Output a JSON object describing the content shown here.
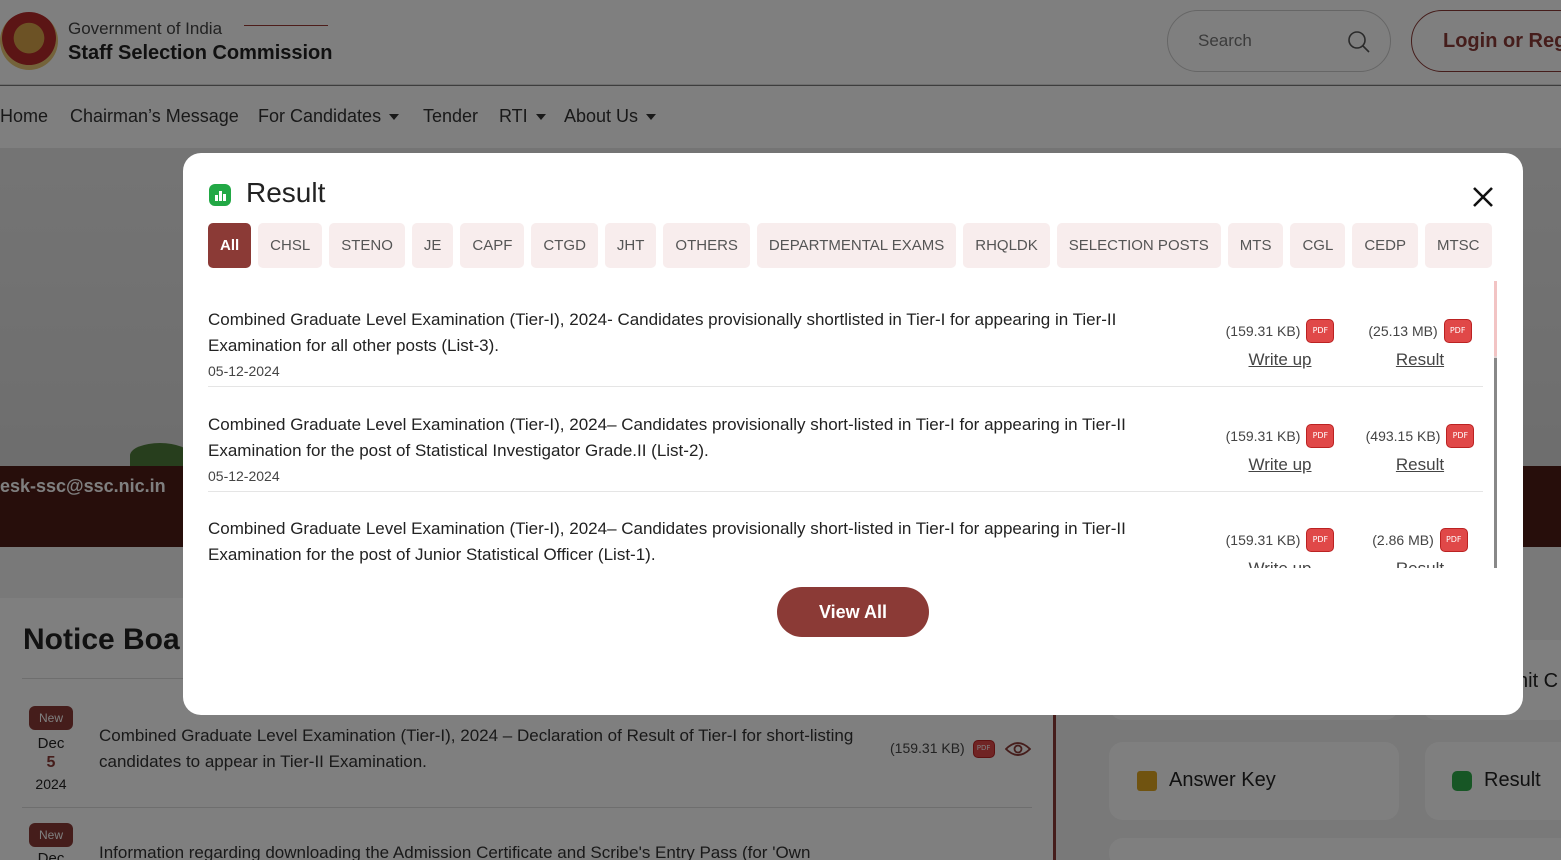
{
  "header": {
    "gov_text": "Government of India",
    "org_name": "Staff Selection Commission",
    "search_placeholder": "Search",
    "login_label": "Login or Reg"
  },
  "nav": {
    "items": [
      "Home",
      "Chairman’s Message",
      "For Candidates",
      "Tender",
      "RTI",
      "About Us"
    ]
  },
  "hero": {
    "email": "esk-ssc@ssc.nic.in"
  },
  "notice_board": {
    "title": "Notice Boa",
    "badge": "New",
    "items": [
      {
        "month": "Dec",
        "day": "5",
        "year": "2024",
        "text": "Combined Graduate Level Examination (Tier-I), 2024 – Declaration of Result of Tier-I for short-listing candidates to appear in Tier-II Examination.",
        "size": "(159.31 KB)"
      },
      {
        "month": "Dec",
        "text": "Information regarding downloading the Admission Certificate and Scribe's Entry Pass (for 'Own"
      }
    ]
  },
  "side": {
    "answer_key": "Answer Key",
    "result": "Result",
    "partial_label": "nit C"
  },
  "modal": {
    "title": "Result",
    "tabs": [
      "All",
      "CHSL",
      "STENO",
      "JE",
      "CAPF",
      "CTGD",
      "JHT",
      "OTHERS",
      "DEPARTMENTAL EXAMS",
      "RHQLDK",
      "SELECTION POSTS",
      "MTS",
      "CGL",
      "CEDP",
      "MTSC"
    ],
    "active_tab": "All",
    "pdf_label": "PDF",
    "items": [
      {
        "title": "Combined Graduate Level Examination (Tier-I), 2024- Candidates provisionally shortlisted in Tier-I for appearing in Tier-II Examination for all other posts (List-3).",
        "date": "05-12-2024",
        "writeup_size": "(159.31 KB)",
        "writeup_label": "Write up",
        "result_size": "(25.13 MB)",
        "result_label": "Result"
      },
      {
        "title": "Combined Graduate Level Examination (Tier-I), 2024– Candidates provisionally short-listed in Tier-I for appearing in Tier-II Examination for the post of Statistical Investigator Grade.II (List-2).",
        "date": "05-12-2024",
        "writeup_size": "(159.31 KB)",
        "writeup_label": "Write up",
        "result_size": "(493.15 KB)",
        "result_label": "Result"
      },
      {
        "title": "Combined Graduate Level Examination (Tier-I), 2024– Candidates provisionally short-listed in Tier-I for appearing in Tier-II Examination for the post of Junior Statistical Officer (List-1).",
        "date": "",
        "writeup_size": "(159.31 KB)",
        "writeup_label": "Write up",
        "result_size": "(2.86 MB)",
        "result_label": "Result"
      }
    ],
    "view_all_label": "View All"
  },
  "colors": {
    "brand": "#8b3a36",
    "tab_bg": "#f8eded",
    "result_icon": "#22a845",
    "pdf": "#e04848"
  }
}
